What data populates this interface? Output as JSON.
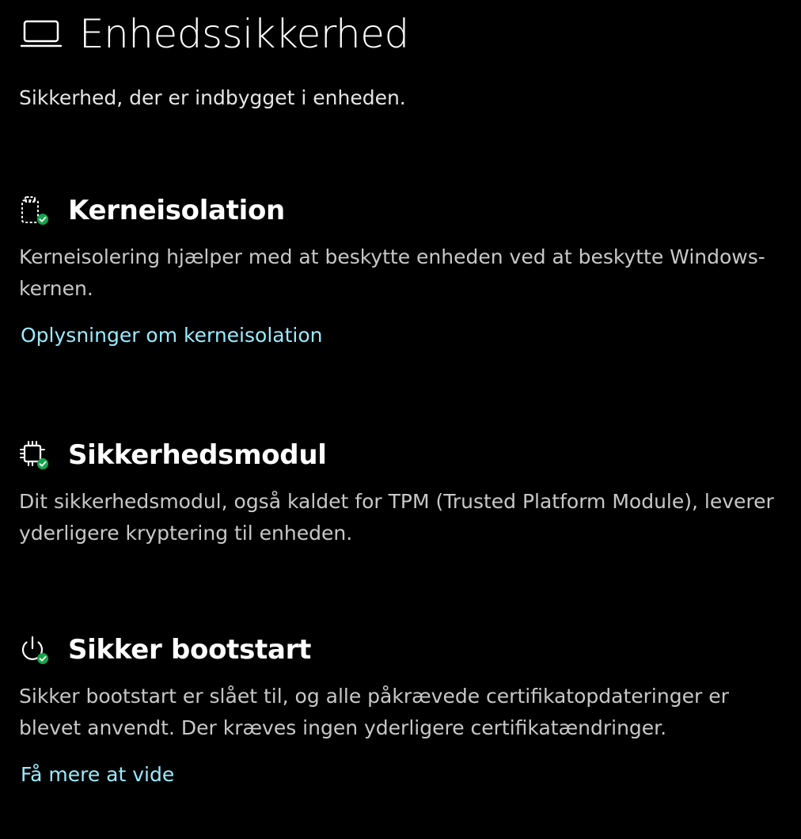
{
  "page": {
    "title": "Enhedssikkerhed",
    "subtitle": "Sikkerhed, der er indbygget i enheden.",
    "header_icon": "laptop-icon"
  },
  "colors": {
    "background": "#000000",
    "text": "#ffffff",
    "description": "#c8c8c8",
    "link": "#99ebff",
    "status_ok": "#16a34a"
  },
  "sections": [
    {
      "icon": "core-isolation-icon",
      "status": "ok",
      "title": "Kerneisolation",
      "description": "Kerneisolering hjælper med at beskytte enheden ved at beskytte Windows-kernen.",
      "link": "Oplysninger om kerneisolation"
    },
    {
      "icon": "security-processor-icon",
      "status": "ok",
      "title": "Sikkerhedsmodul",
      "description": "Dit sikkerhedsmodul, også kaldet for TPM (Trusted Platform Module), leverer yderligere kryptering til enheden."
    },
    {
      "icon": "secure-boot-icon",
      "status": "ok",
      "title": "Sikker bootstart",
      "description": "Sikker bootstart er slået til, og alle påkrævede certifikatopdateringer er blevet anvendt. Der kræves ingen yderligere certifikatændringer.",
      "link": "Få mere at vide"
    }
  ]
}
